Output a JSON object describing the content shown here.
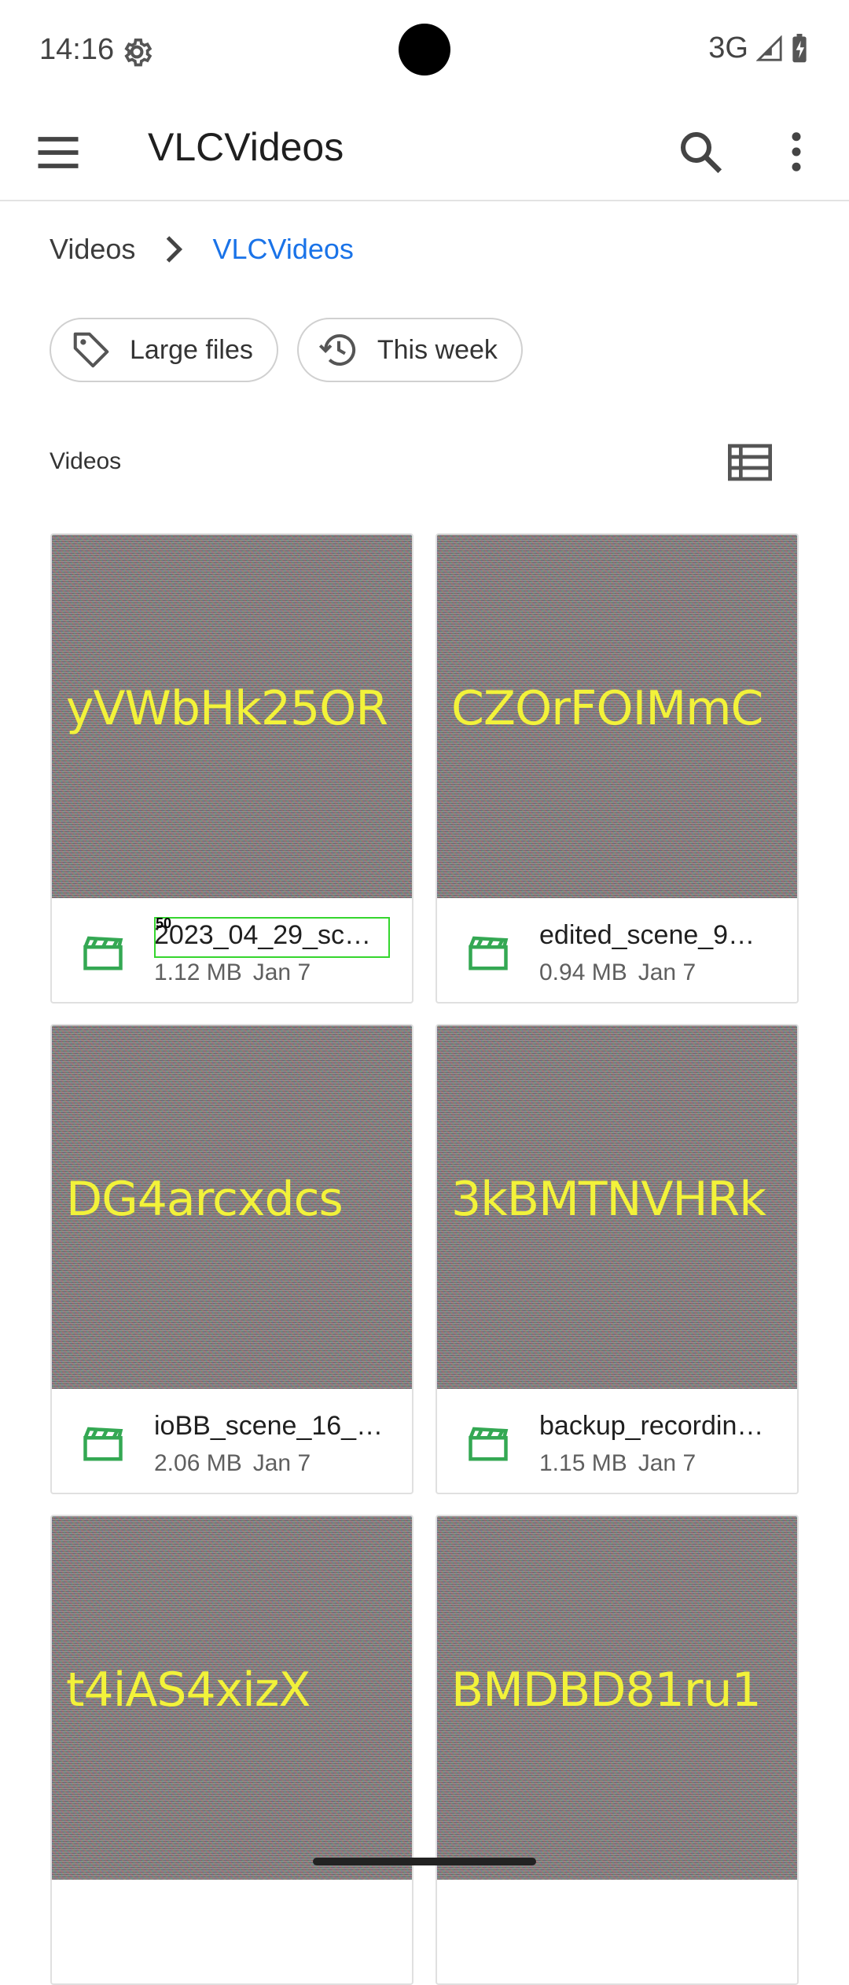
{
  "status": {
    "time": "14:16",
    "network": "3G"
  },
  "appbar": {
    "title": "VLCVideos"
  },
  "breadcrumb": {
    "root": "Videos",
    "current": "VLCVideos"
  },
  "chips": [
    {
      "label": "Large files"
    },
    {
      "label": "This week"
    }
  ],
  "section": {
    "label": "Videos"
  },
  "focus": {
    "number": "50"
  },
  "files": [
    {
      "thumb_text": "yVWbHk25OR",
      "name": "2023_04_29_sc…",
      "size": "1.12 MB",
      "date": "Jan 7"
    },
    {
      "thumb_text": "CZOrFOIMmC",
      "name": "edited_scene_9…",
      "size": "0.94 MB",
      "date": "Jan 7"
    },
    {
      "thumb_text": "DG4arcxdcs",
      "name": "ioBB_scene_16_…",
      "size": "2.06 MB",
      "date": "Jan 7"
    },
    {
      "thumb_text": "3kBMTNVHRk",
      "name": "backup_recordin…",
      "size": "1.15 MB",
      "date": "Jan 7"
    },
    {
      "thumb_text": "t4iAS4xizX",
      "name": "",
      "size": "",
      "date": ""
    },
    {
      "thumb_text": "BMDBD81ru1",
      "name": "",
      "size": "",
      "date": ""
    }
  ],
  "colors": {
    "accent": "#1a73e8",
    "file_icon": "#34a853",
    "thumb_text": "#f2f23a"
  }
}
